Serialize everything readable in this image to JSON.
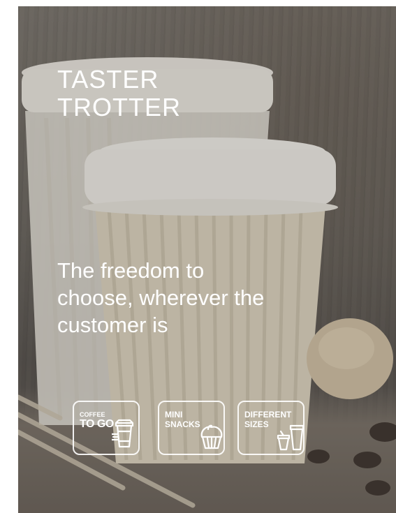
{
  "hero": {
    "title_line1": "TASTER",
    "title_line2": "TROTTER",
    "tagline": "The freedom to choose, wherever the customer is"
  },
  "badges": [
    {
      "line1": "COFFEE",
      "line2": "TO GO",
      "icon": "takeaway-cup-icon"
    },
    {
      "line1": "MINI",
      "line2": "SNACKS",
      "icon": "muffin-icon"
    },
    {
      "line1": "DIFFERENT",
      "line2": "SIZES",
      "icon": "cup-sizes-icon"
    }
  ],
  "colors": {
    "text": "#ffffff",
    "overlay": "#5f5c58",
    "cup": "#e7e4dd"
  }
}
